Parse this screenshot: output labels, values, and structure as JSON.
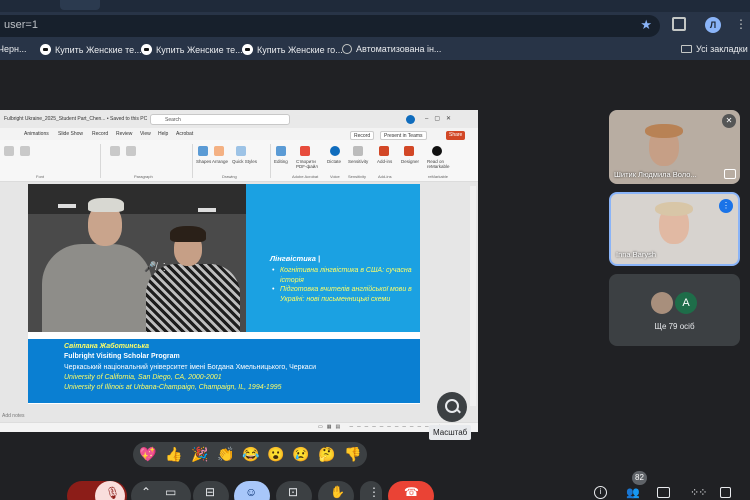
{
  "browser": {
    "url_fragment": "user=1",
    "profile_initial": "Л",
    "bookmarks": [
      {
        "label": "Черн..."
      },
      {
        "label": "Купить Женские те..."
      },
      {
        "label": "Купить Женские те..."
      },
      {
        "label": "Купить Женские го..."
      },
      {
        "label": "Автоматизована ін..."
      }
    ],
    "all_bookmarks_label": "Усі закладки"
  },
  "presentation": {
    "file_title": "Fulbright Ukraine_2025_Student Part_Chen... • Saved to this PC",
    "search_placeholder": "Search",
    "menu": [
      "Animations",
      "Slide Show",
      "Record",
      "Review",
      "View",
      "Help",
      "Acrobat"
    ],
    "record_label": "Record",
    "present_label": "Present in Teams",
    "share_label": "Share",
    "ribbon_items": [
      "Shapes",
      "Arrange",
      "Quick Styles",
      "Editing",
      "Створити PDF-файл",
      "Dictate",
      "Sensitivity",
      "Add-ins",
      "Designer",
      "Read on reMarkable"
    ],
    "ribbon_groups": [
      "Font",
      "Paragraph",
      "Drawing",
      "Adobe Acrobat",
      "Voice",
      "Sensitivity",
      "Add-ins",
      "reMarkable"
    ],
    "add_notes": "Add notes",
    "slide": {
      "heading": "Лінгвістика |",
      "bullets": [
        "Когнітивна лінгвістика в США: сучасна історія",
        "Підготовка вчителів англійської мови в Україні: нові письменницькі схеми"
      ],
      "name": "Світлана Жаботинська",
      "program": "Fulbright Visiting Scholar Program",
      "affiliation": "Черкаський національний університет імені Богдана Хмельницького, Черкаси",
      "line4": "University of California, San Diego, CA, 2000-2001",
      "line5": "University of Illinois at Urbana-Champaign, Champaign, IL, 1994-1995"
    }
  },
  "zoom": {
    "tooltip": "Масштаб",
    "icon": "zoom-in-icon"
  },
  "participants": [
    {
      "name": "Шитик Людмила Воло...",
      "muted": true
    },
    {
      "name": "Inna Barysh",
      "speaking": true
    }
  ],
  "others": {
    "avatar_letter": "A",
    "label": "Ще 79 осіб"
  },
  "reactions": [
    "💖",
    "👍",
    "🎉",
    "👏",
    "😂",
    "😮",
    "😢",
    "🤔",
    "👎"
  ],
  "controls": {
    "people_count": "82"
  },
  "colors": {
    "meet_bg": "#202124",
    "accent_blue": "#8ab4f8",
    "slide_blue": "#1ba1e2",
    "slide_dark_blue": "#0a7fd2",
    "hangup_red": "#ea4335",
    "slide_yellow": "#ffff66"
  }
}
